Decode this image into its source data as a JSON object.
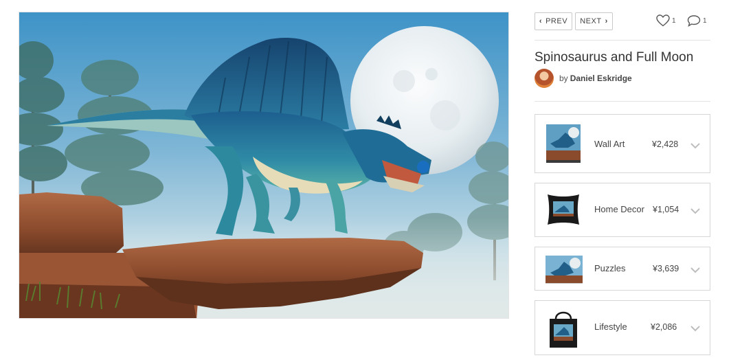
{
  "artwork": {
    "description_icon": "artwork-image"
  },
  "nav": {
    "prev_label": "PREV",
    "next_label": "NEXT"
  },
  "stats": {
    "likes": "1",
    "comments": "1"
  },
  "title": "Spinosaurus and Full Moon",
  "artist": {
    "by": "by",
    "name": "Daniel Eskridge"
  },
  "products": [
    {
      "label": "Wall Art",
      "price": "¥2,428"
    },
    {
      "label": "Home Decor",
      "price": "¥1,054"
    },
    {
      "label": "Puzzles",
      "price": "¥3,639"
    },
    {
      "label": "Lifestyle",
      "price": "¥2,086"
    }
  ],
  "icons": {
    "prev": "chevron-left-icon",
    "next": "chevron-right-icon",
    "likes": "heart-icon",
    "comments": "comment-icon",
    "expand": "chevron-down-icon"
  }
}
